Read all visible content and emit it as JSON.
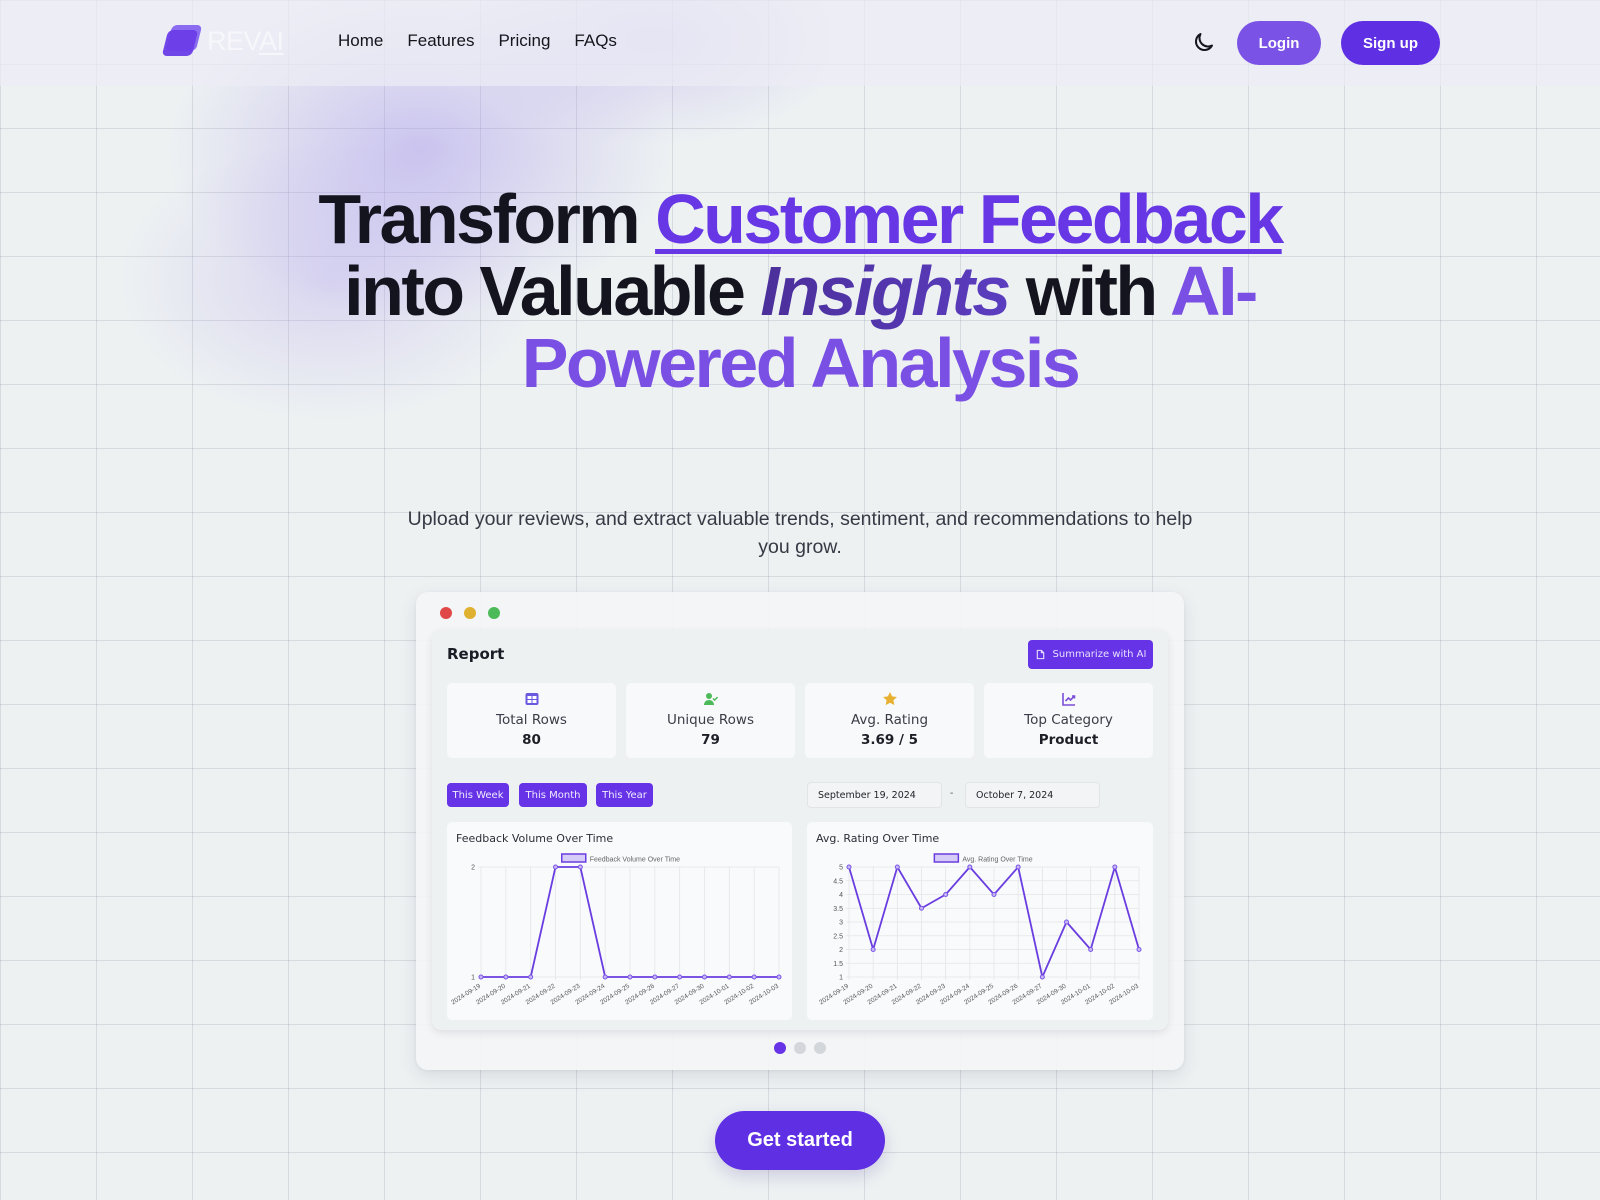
{
  "nav": {
    "logo_main": "REV",
    "logo_accent": "AI",
    "links": [
      "Home",
      "Features",
      "Pricing",
      "FAQs"
    ],
    "theme_icon": "moon-icon",
    "login_label": "Login",
    "signup_label": "Sign up"
  },
  "hero": {
    "title_parts": {
      "p1": "Transform ",
      "p2": "Customer Feedback",
      "p3": " into Valuable ",
      "p4": "Insights",
      "p5": " with ",
      "p6": "AI-Powered Analysis"
    },
    "subtitle": "Upload your reviews, and extract valuable trends, sentiment, and recommendations to help you grow.",
    "cta_label": "Get started"
  },
  "colors": {
    "accent": "#6633e6",
    "accent_light": "#7a52e6",
    "background": "#edf1f2",
    "window_red": "#e04848",
    "window_yellow": "#e0b030",
    "window_green": "#4cba58"
  },
  "dashboard": {
    "report_title": "Report",
    "summarize_label": "Summarize with AI",
    "summarize_icon": "document-icon",
    "stats": [
      {
        "label": "Total Rows",
        "value": "80",
        "icon": "table-icon",
        "color": "#6a5ae0"
      },
      {
        "label": "Unique Rows",
        "value": "79",
        "icon": "user-check-icon",
        "color": "#4cba58"
      },
      {
        "label": "Avg. Rating",
        "value": "3.69 / 5",
        "icon": "star-icon",
        "color": "#e8b030"
      },
      {
        "label": "Top Category",
        "value": "Product",
        "icon": "chart-line-icon",
        "color": "#7a4fd8"
      }
    ],
    "range_buttons": [
      "This Week",
      "This Month",
      "This Year"
    ],
    "date_from": "September 19, 2024",
    "date_separator": "-",
    "date_to": "October 7, 2024",
    "carousel": {
      "total": 3,
      "active": 1
    }
  },
  "chart_data": [
    {
      "type": "line",
      "title": "Feedback Volume Over Time",
      "legend": "Feedback Volume Over Time",
      "legend_position": "top",
      "x": [
        "2024-09-19",
        "2024-09-20",
        "2024-09-21",
        "2024-09-22",
        "2024-09-23",
        "2024-09-24",
        "2024-09-25",
        "2024-09-26",
        "2024-09-27",
        "2024-09-30",
        "2024-10-01",
        "2024-10-02",
        "2024-10-03"
      ],
      "values": [
        1,
        1,
        1,
        2,
        2,
        1,
        1,
        1,
        1,
        1,
        1,
        1,
        1
      ],
      "yticks": [
        1,
        2
      ],
      "ylim": [
        1,
        2
      ],
      "grid": true,
      "xlabel": "",
      "ylabel": ""
    },
    {
      "type": "line",
      "title": "Avg. Rating Over Time",
      "legend": "Avg. Rating Over Time",
      "legend_position": "top",
      "x": [
        "2024-09-19",
        "2024-09-20",
        "2024-09-21",
        "2024-09-22",
        "2024-09-23",
        "2024-09-24",
        "2024-09-25",
        "2024-09-26",
        "2024-09-27",
        "2024-09-30",
        "2024-10-01",
        "2024-10-02",
        "2024-10-03"
      ],
      "values": [
        5,
        2,
        5,
        3.5,
        4,
        5,
        4,
        5,
        1,
        3,
        2,
        5,
        2
      ],
      "yticks": [
        1,
        1.5,
        2,
        2.5,
        3,
        3.5,
        4,
        4.5,
        5
      ],
      "ylim": [
        1,
        5
      ],
      "grid": true,
      "xlabel": "",
      "ylabel": ""
    }
  ]
}
